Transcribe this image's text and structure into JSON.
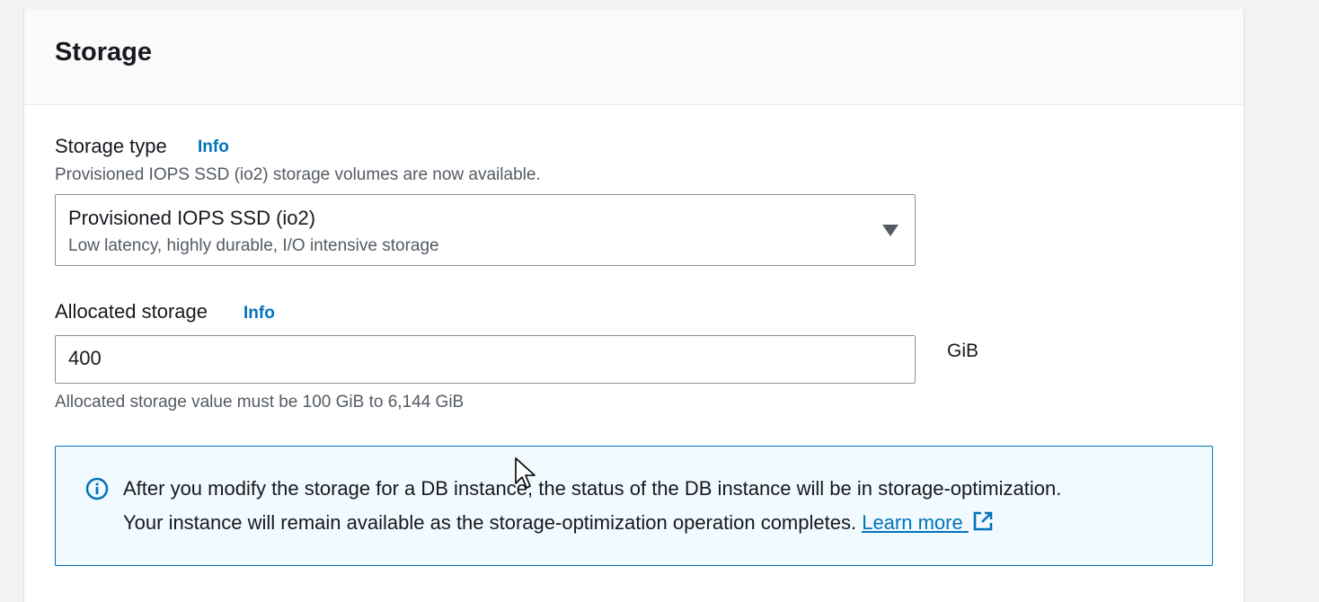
{
  "section": {
    "title": "Storage"
  },
  "storage_type": {
    "label": "Storage type",
    "info_link": "Info",
    "description": "Provisioned IOPS SSD (io2) storage volumes are now available.",
    "selected_value": "Provisioned IOPS SSD (io2)",
    "selected_description": "Low latency, highly durable, I/O intensive storage",
    "caret_icon": "caret-down-icon"
  },
  "allocated_storage": {
    "label": "Allocated storage",
    "info_link": "Info",
    "value": "400",
    "unit": "GiB",
    "constraint": "Allocated storage value must be 100 GiB to 6,144 GiB"
  },
  "alert": {
    "icon": "info-circle-icon",
    "line1": "After you modify the storage for a DB instance, the status of the DB instance will be in storage-optimization.",
    "line2": "Your instance will remain available as the storage-optimization operation completes.",
    "link_text": "Learn more",
    "link_icon": "external-link-icon"
  },
  "colors": {
    "link": "#0073bb",
    "alert_border": "#0073bb",
    "alert_background": "#f1faff",
    "text": "#16191f",
    "secondary_text": "#545b64"
  }
}
